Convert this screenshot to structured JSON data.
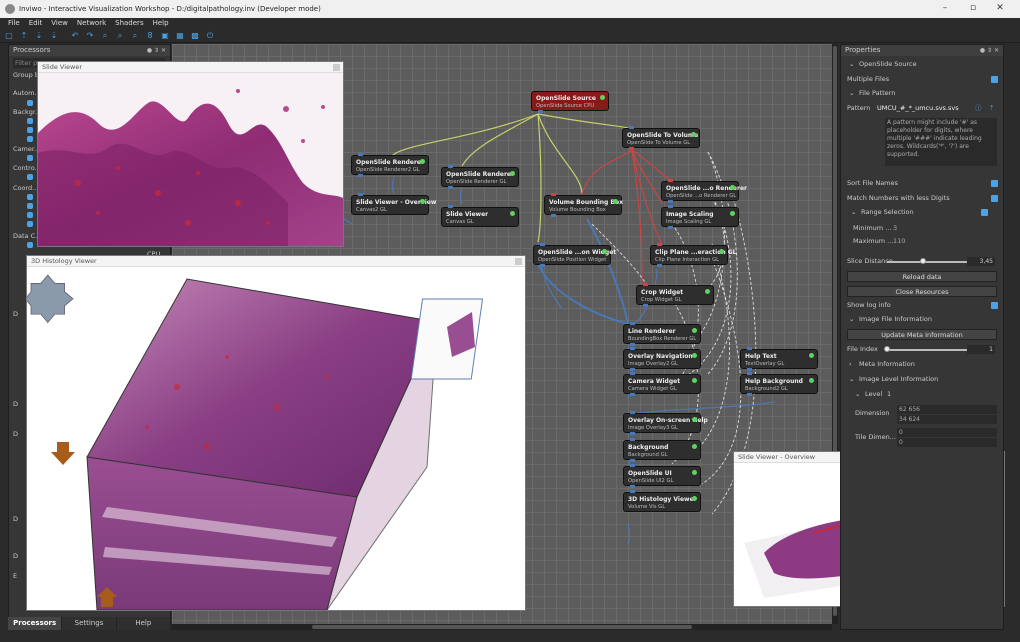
{
  "window": {
    "title": "Inviwo - Interactive Visualization Workshop - D:/digitalpathology.inv (Developer mode)",
    "minimize": "–",
    "maximize": "▫",
    "close": "✕"
  },
  "menu": [
    "File",
    "Edit",
    "View",
    "Network",
    "Shaders",
    "Help"
  ],
  "toolbar_icons": [
    "new-icon",
    "open-icon",
    "save-icon",
    "save-as-icon",
    "undo-icon",
    "redo-icon",
    "zoom-in-icon",
    "zoom-out-icon",
    "zoom-fit-icon",
    "snap-icon",
    "lock-icon",
    "image-icon",
    "camera-icon",
    "power-icon"
  ],
  "processors_panel": {
    "title": "Processors",
    "filter_placeholder": "Filter pr...",
    "group_by": "Group b...",
    "tree": [
      "Autom...",
      "Backgr...",
      "Camer...",
      "Contro...",
      "Coord...",
      "Data C..."
    ],
    "tree_right_label": "CPU",
    "partial_rows": [
      "D",
      "D",
      "D",
      "D",
      "D",
      "E"
    ],
    "tabs": [
      "Processors",
      "Settings",
      "Help"
    ]
  },
  "views": {
    "slide_viewer": "Slide Viewer",
    "histology_viewer": "3D Histology Viewer",
    "slide_overview": "Slide Viewer - Overview"
  },
  "processors": [
    {
      "name": "OpenSlide Source",
      "sub": "OpenSlide Source CPU"
    },
    {
      "name": "OpenSlide To Volume",
      "sub": "OpenSlide To Volume GL"
    },
    {
      "name": "OpenSlide Renderer",
      "sub": "OpenSlide Renderer2 GL"
    },
    {
      "name": "OpenSlide Renderer",
      "sub": "OpenSlide Renderer GL"
    },
    {
      "name": "OpenSlide ...o Renderer",
      "sub": "OpenSlide ...o Renderer GL"
    },
    {
      "name": "Slide Viewer - Overview",
      "sub": "Canvas2 GL"
    },
    {
      "name": "Slide Viewer",
      "sub": "Canvas GL"
    },
    {
      "name": "Volume Bounding Box",
      "sub": "Volume Bounding Box"
    },
    {
      "name": "Image Scaling",
      "sub": "Image Scaling GL"
    },
    {
      "name": "OpenSlide ...on Widget",
      "sub": "OpenSlide Position Widget"
    },
    {
      "name": "Clip Plane ...eraction GL",
      "sub": "Clip Plane Interaction GL"
    },
    {
      "name": "Crop Widget",
      "sub": "Crop Widget GL"
    },
    {
      "name": "Line Renderer",
      "sub": "BoundingBox Renderer GL"
    },
    {
      "name": "Overlay Navigation",
      "sub": "Image Overlay2 GL"
    },
    {
      "name": "Help Text",
      "sub": "TextOverlay GL"
    },
    {
      "name": "Camera Widget",
      "sub": "Camera Widget GL"
    },
    {
      "name": "Help Background",
      "sub": "Background2 GL"
    },
    {
      "name": "Overlay On-screen Help",
      "sub": "Image Overlay3 GL"
    },
    {
      "name": "Background",
      "sub": "Background GL"
    },
    {
      "name": "OpenSlide UI",
      "sub": "OpenSlide UI2 GL"
    },
    {
      "name": "3D Histology Viewer",
      "sub": "Volume Vis GL"
    }
  ],
  "properties_panel": {
    "title": "Properties",
    "source": "OpenSlide Source",
    "multiple_files": "Multiple Files",
    "file_pattern": "File Pattern",
    "pattern_label": "Pattern",
    "pattern_value": "UMCU_#_*_umcu.svs.svs",
    "help_text": "A pattern might include '#' as placeholder for digits, where multiple '###' indicate leading zeros. Wildcards('*', '?') are supported.",
    "sort_file_names": "Sort File Names",
    "match_numbers": "Match Numbers with less Digits",
    "range_selection": "Range Selection",
    "minimum_label": "Minimum ...",
    "minimum_value": "3",
    "maximum_label": "Maximum ...",
    "maximum_value": "110",
    "slice_distance_label": "Slice Distance",
    "slice_distance_value": "3,45",
    "slice_distance_level": 0.45,
    "reload_button": "Reload data",
    "close_button": "Close Resources",
    "show_log_info": "Show log info",
    "image_file_information": "Image File Information",
    "update_meta_button": "Update Meta Information",
    "file_index_label": "File Index",
    "file_index_value": "1",
    "file_index_level": 0.0,
    "meta_information": "Meta Information",
    "image_level_information": "Image Level Information",
    "level_label": "Level",
    "level_value": "1",
    "dimension_label": "Dimension",
    "dimension_values": [
      "62 656",
      "34 624"
    ],
    "tile_dim_label": "Tile Dimen...",
    "tile_dim_values": [
      "0",
      "0"
    ]
  },
  "colors": {
    "accent": "#4aa3e8",
    "source_node": "#8a1a1a",
    "led_on": "#5fd35f",
    "canvas_bg": "#5c5c5c"
  }
}
